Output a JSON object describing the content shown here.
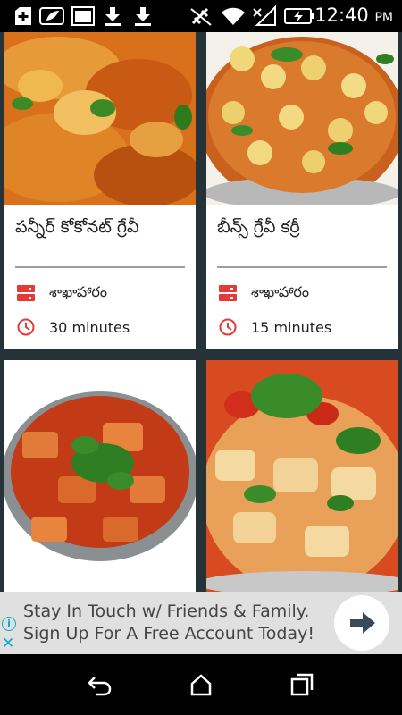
{
  "status_bar": {
    "time": "12:40",
    "ampm": "PM",
    "icons": [
      "add-box-icon",
      "leaf-icon",
      "image-icon",
      "download-icon",
      "download-icon",
      "signal-muted-icon",
      "wifi-icon",
      "no-signal-icon",
      "battery-charging-icon"
    ]
  },
  "recipes": [
    {
      "title": "పన్నీర్ కోకోనట్ గ్రేవీ",
      "category": "శాఖాహారం",
      "time": "30 minutes"
    },
    {
      "title": "బీన్స్ గ్రేవీ కర్రీ",
      "category": "శాఖాహారం",
      "time": "15 minutes"
    },
    {
      "title": "",
      "category": "",
      "time": ""
    },
    {
      "title": "",
      "category": "",
      "time": ""
    }
  ],
  "icons": {
    "category": "category-icon",
    "time": "clock-icon"
  },
  "colors": {
    "accent": "#e53935",
    "background": "#263238"
  },
  "ad": {
    "line1": "Stay In Touch w/ Friends & Family.",
    "line2": "Sign Up For A Free Account Today!",
    "info_icon": "info-icon",
    "close_icon": "close-icon",
    "cta_icon": "arrow-right-icon"
  },
  "nav": {
    "back": "back-icon",
    "home": "home-icon",
    "recents": "recents-icon"
  }
}
